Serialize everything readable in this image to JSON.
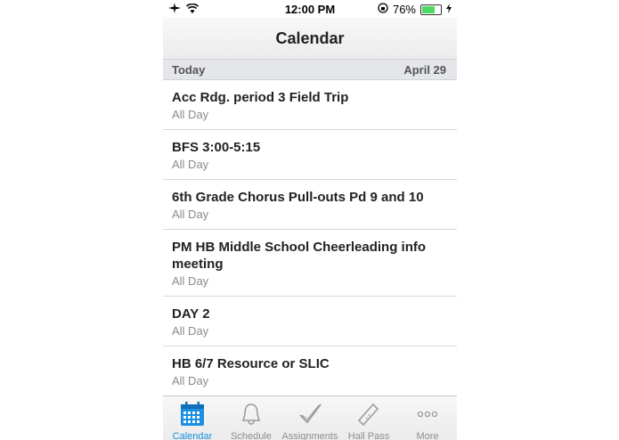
{
  "status_bar": {
    "time": "12:00 PM",
    "battery_percent": "76%",
    "battery_level": 0.76
  },
  "nav": {
    "title": "Calendar"
  },
  "section": {
    "left": "Today",
    "right": "April 29"
  },
  "events": [
    {
      "title": "Acc Rdg. period 3 Field Trip",
      "subtitle": "All Day"
    },
    {
      "title": "BFS 3:00-5:15",
      "subtitle": "All Day"
    },
    {
      "title": "6th Grade Chorus Pull-outs Pd 9 and 10",
      "subtitle": "All Day"
    },
    {
      "title": "PM HB Middle School Cheerleading info meeting",
      "subtitle": "All Day"
    },
    {
      "title": "DAY 2",
      "subtitle": "All Day"
    },
    {
      "title": "HB 6/7 Resource or SLIC",
      "subtitle": "All Day"
    }
  ],
  "tabs": [
    {
      "label": "Calendar",
      "icon": "calendar-icon",
      "active": true
    },
    {
      "label": "Schedule",
      "icon": "bell-icon"
    },
    {
      "label": "Assignments",
      "icon": "checkmark-icon"
    },
    {
      "label": "Hall Pass",
      "icon": "ticket-icon"
    },
    {
      "label": "More",
      "icon": "more-dots-icon"
    }
  ],
  "colors": {
    "accent": "#1a8fe3",
    "battery": "#4cd964"
  }
}
